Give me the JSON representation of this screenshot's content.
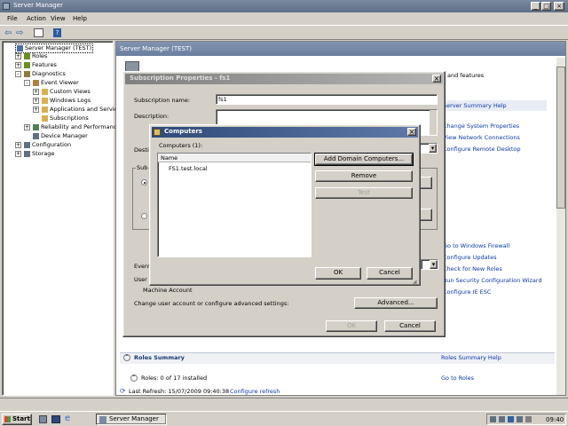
{
  "window": {
    "title": "Server Manager"
  },
  "menu": [
    "File",
    "Action",
    "View",
    "Help"
  ],
  "tree": {
    "items": [
      {
        "label": "Server Manager (TEST)",
        "indent": 0,
        "expander": "",
        "color": "#4a6fa5"
      },
      {
        "label": "Roles",
        "indent": 1,
        "expander": "+",
        "color": "#6b8e23"
      },
      {
        "label": "Features",
        "indent": 1,
        "expander": "+",
        "color": "#6b8e23"
      },
      {
        "label": "Diagnostics",
        "indent": 1,
        "expander": "-",
        "color": "#8b7d3a"
      },
      {
        "label": "Event Viewer",
        "indent": 2,
        "expander": "-",
        "color": "#b08040"
      },
      {
        "label": "Custom Views",
        "indent": 3,
        "expander": "+",
        "color": "#d8b050"
      },
      {
        "label": "Windows Logs",
        "indent": 3,
        "expander": "+",
        "color": "#d8b050"
      },
      {
        "label": "Applications and Servic",
        "indent": 3,
        "expander": "+",
        "color": "#d8b050"
      },
      {
        "label": "Subscriptions",
        "indent": 3,
        "expander": "",
        "color": "#d8b050"
      },
      {
        "label": "Reliability and Performance",
        "indent": 2,
        "expander": "+",
        "color": "#508050"
      },
      {
        "label": "Device Manager",
        "indent": 2,
        "expander": "",
        "color": "#607080"
      },
      {
        "label": "Configuration",
        "indent": 1,
        "expander": "+",
        "color": "#607080"
      },
      {
        "label": "Storage",
        "indent": 1,
        "expander": "+",
        "color": "#607080"
      }
    ]
  },
  "main": {
    "header": "Server Manager (TEST)",
    "partial_text": "and features",
    "server_summary_help": "Server Summary Help",
    "links_right_top": [
      "Change System Properties",
      "View Network Connections",
      "Configure Remote Desktop"
    ],
    "links_right_mid": [
      "Go to Windows Firewall",
      "Configure Updates",
      "Check for New Roles",
      "Run Security Configuration Wizard",
      "Configure IE ESC"
    ],
    "roles_summary": "Roles Summary",
    "roles_summary_help": "Roles Summary Help",
    "roles_count": "Roles: 0 of 17 installed",
    "go_to_roles": "Go to Roles",
    "last_refresh": "Last Refresh: 15/07/2009 09:40:38",
    "configure_refresh": "Configure refresh"
  },
  "subscription_dialog": {
    "title": "Subscription Properties - fs1",
    "name_label": "Subscription name:",
    "name_value": "fs1",
    "description_label": "Description:",
    "dest_label": "Desti",
    "sub_label": "Sub",
    "event_label": "Event",
    "user_label": "User",
    "machine_account": "Machine Account",
    "change_user_text": "Change user account or configure advanced settings:",
    "advanced_button": "Advanced...",
    "ok_button": "OK",
    "cancel_button": "Cancel"
  },
  "computers_dialog": {
    "title": "Computers",
    "computers_label": "Computers (1):",
    "column_name": "Name",
    "rows": [
      "FS1.test.local"
    ],
    "add_button": "Add Domain Computers...",
    "remove_button": "Remove",
    "test_button": "Test",
    "ok_button": "OK",
    "cancel_button": "Cancel"
  },
  "taskbar": {
    "start": "Start",
    "task": "Server Manager",
    "clock": "09:40"
  }
}
